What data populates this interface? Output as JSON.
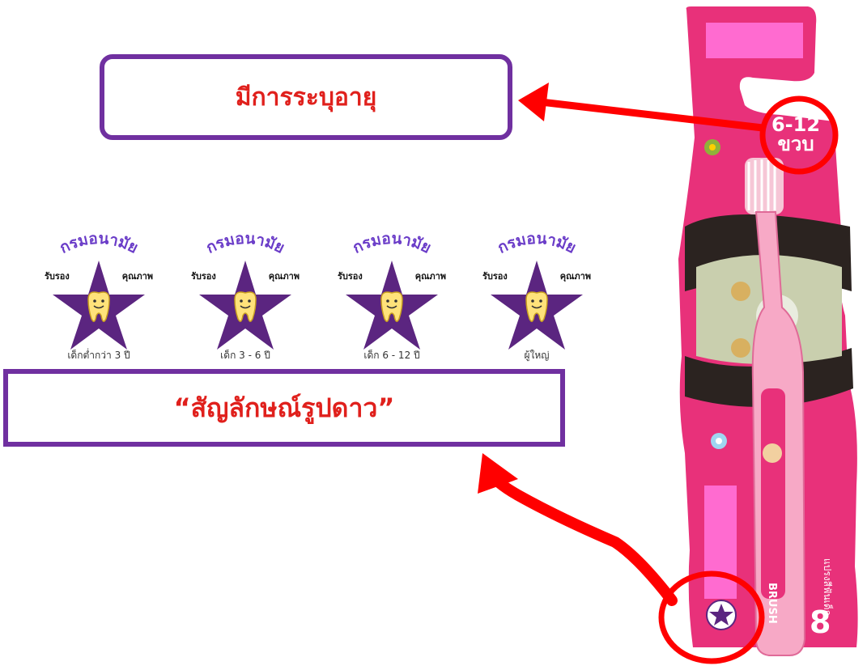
{
  "callouts": {
    "age_text": "มีการระบุอายุ",
    "star_text": "“สัญลักษณ์รูปดาว”"
  },
  "badges": [
    {
      "arc": "กรมอนามัย",
      "left": "รับรอง",
      "right": "คุณภาพ",
      "caption": "เด็กต่ำกว่า 3 ปี"
    },
    {
      "arc": "กรมอนามัย",
      "left": "รับรอง",
      "right": "คุณภาพ",
      "caption": "เด็ก 3 - 6 ปี"
    },
    {
      "arc": "กรมอนามัย",
      "left": "รับรอง",
      "right": "คุณภาพ",
      "caption": "เด็ก 6 - 12 ปี"
    },
    {
      "arc": "กรมอนามัย",
      "left": "รับรอง",
      "right": "คุณภาพ",
      "caption": "ผู้ใหญ่"
    }
  ],
  "package": {
    "age_line1": "6-12",
    "age_line2": "ขวบ",
    "brand": "BRUSH",
    "side_text": "แปรงสีฟันเด็ก",
    "big_digit": "8"
  },
  "colors": {
    "callout_border": "#7030a0",
    "callout_text": "#e0201c",
    "star": "#5b2580",
    "package_pink": "#e8317a",
    "annotation_red": "#ff0000"
  }
}
